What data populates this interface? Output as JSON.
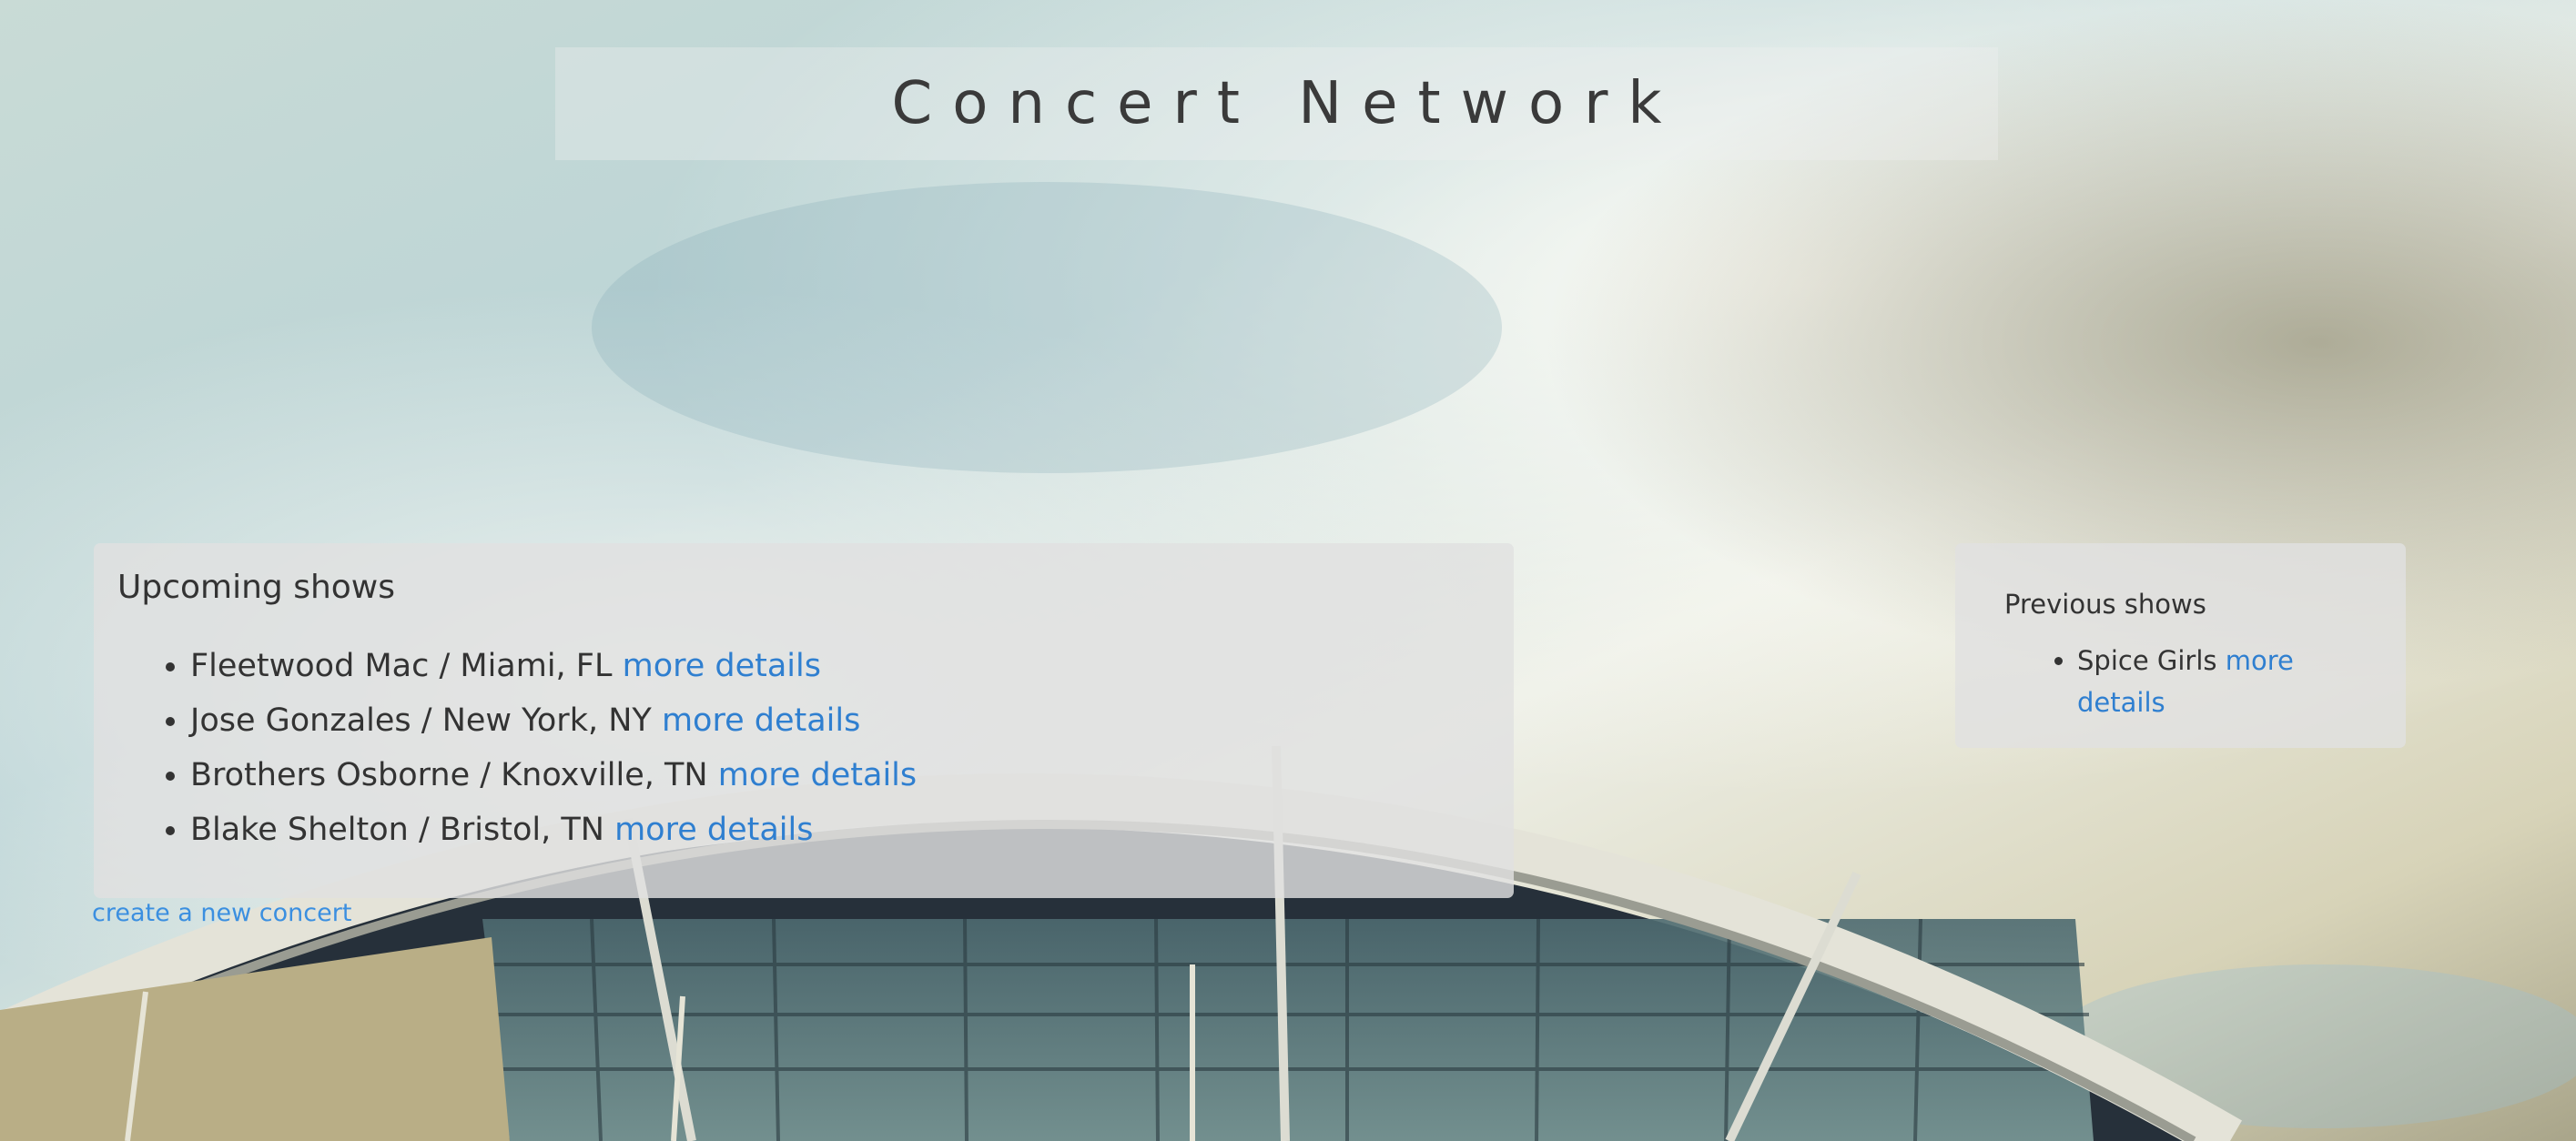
{
  "header": {
    "title": "Concert Network"
  },
  "upcoming": {
    "heading": "Upcoming shows",
    "shows": [
      {
        "text": "Fleetwood Mac / Miami, FL",
        "link": "more details"
      },
      {
        "text": "Jose Gonzales / New York, NY",
        "link": "more details"
      },
      {
        "text": "Brothers Osborne / Knoxville, TN",
        "link": "more details"
      },
      {
        "text": "Blake Shelton / Bristol, TN",
        "link": "more details"
      }
    ]
  },
  "create_link": "create a new concert",
  "previous": {
    "heading": "Previous shows",
    "shows": [
      {
        "text": "Spice Girls",
        "link": "more details"
      }
    ]
  },
  "colors": {
    "link": "#2f7fd0",
    "text": "#333333",
    "panel": "#e1e1e1"
  }
}
